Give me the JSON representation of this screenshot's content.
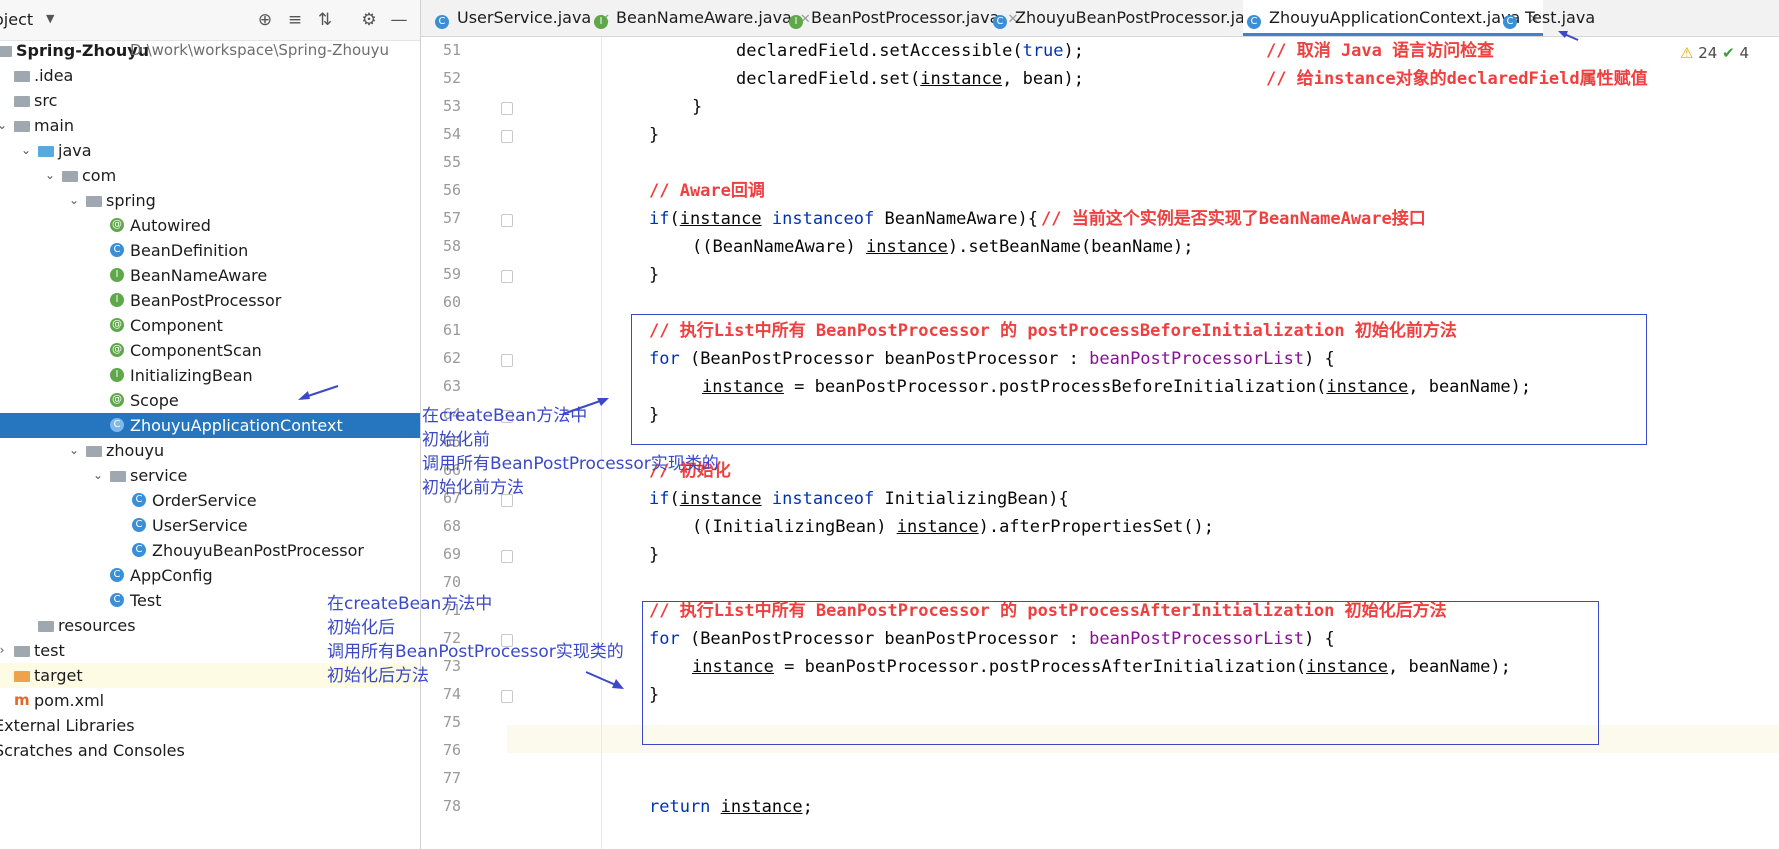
{
  "project_panel": {
    "title": "oject",
    "toolbar_icons": [
      "locate-icon",
      "expand-all-icon",
      "collapse-all-icon",
      "settings-icon",
      "hide-icon"
    ],
    "tree": [
      {
        "label": "Spring-Zhouyu",
        "path": "D:\\work\\workspace\\Spring-Zhouyu",
        "icon": "module-icon"
      },
      {
        "label": ".idea",
        "icon": "folder-icon"
      },
      {
        "label": "src",
        "icon": "folder-icon"
      },
      {
        "label": "main",
        "icon": "folder-icon"
      },
      {
        "label": "java",
        "icon": "source-folder-icon"
      },
      {
        "label": "com",
        "icon": "package-icon"
      },
      {
        "label": "spring",
        "icon": "package-icon"
      },
      {
        "label": "Autowired",
        "icon": "annotation-icon"
      },
      {
        "label": "BeanDefinition",
        "icon": "class-icon"
      },
      {
        "label": "BeanNameAware",
        "icon": "interface-icon"
      },
      {
        "label": "BeanPostProcessor",
        "icon": "interface-icon"
      },
      {
        "label": "Component",
        "icon": "annotation-icon"
      },
      {
        "label": "ComponentScan",
        "icon": "annotation-icon"
      },
      {
        "label": "InitializingBean",
        "icon": "interface-icon"
      },
      {
        "label": "Scope",
        "icon": "annotation-icon"
      },
      {
        "label": "ZhouyuApplicationContext",
        "icon": "class-icon"
      },
      {
        "label": "zhouyu",
        "icon": "package-icon"
      },
      {
        "label": "service",
        "icon": "package-icon"
      },
      {
        "label": "OrderService",
        "icon": "class-icon"
      },
      {
        "label": "UserService",
        "icon": "class-icon"
      },
      {
        "label": "ZhouyuBeanPostProcessor",
        "icon": "class-icon"
      },
      {
        "label": "AppConfig",
        "icon": "class-icon"
      },
      {
        "label": "Test",
        "icon": "runnable-class-icon"
      },
      {
        "label": "resources",
        "icon": "resources-folder-icon"
      },
      {
        "label": "test",
        "icon": "folder-icon"
      },
      {
        "label": "target",
        "icon": "excluded-folder-icon"
      },
      {
        "label": "pom.xml",
        "icon": "maven-icon"
      },
      {
        "label": "External Libraries",
        "icon": "library-icon"
      },
      {
        "label": "Scratches and Consoles",
        "icon": "scratch-icon"
      }
    ]
  },
  "tabs": [
    {
      "label": "UserService.java",
      "icon": "class-icon",
      "color": "#3b8fd6"
    },
    {
      "label": "BeanNameAware.java",
      "icon": "interface-icon",
      "color": "#5ea84a"
    },
    {
      "label": "BeanPostProcessor.java",
      "icon": "interface-icon",
      "color": "#5ea84a"
    },
    {
      "label": "ZhouyuBeanPostProcessor.java",
      "icon": "class-icon",
      "color": "#3b8fd6"
    },
    {
      "label": "ZhouyuApplicationContext.java",
      "icon": "class-icon",
      "color": "#3b8fd6"
    },
    {
      "label": "Test.java",
      "icon": "runnable-class-icon",
      "color": "#3b8fd6"
    }
  ],
  "inspection": {
    "warnings": "24",
    "ok": "4"
  },
  "code": {
    "line_numbers": [
      "51",
      "52",
      "53",
      "54",
      "55",
      "56",
      "57",
      "58",
      "59",
      "60",
      "61",
      "62",
      "63",
      "64",
      "65",
      "66",
      "67",
      "68",
      "69",
      "70",
      "71",
      "72",
      "73",
      "74",
      "75",
      "76",
      "77",
      "78"
    ],
    "l51_code": "declaredField.setAccessible(",
    "l51_kw": "true",
    "l51_end": ");",
    "l51_cmt": "// 取消 Java 语言访问检查",
    "l52_a": "declaredField.set(",
    "l52_inst": "instance",
    "l52_b": ", bean);",
    "l52_cmt": "// 给instance对象的declaredField属性赋值",
    "brace_close": "}",
    "l56_cmt": "// Aware回调",
    "if_kw": "if",
    "paren_open": "(",
    "instance": "instance",
    "instanceof": "instanceof",
    "l57_type": " BeanNameAware){",
    "l57_cmt": "// 当前这个实例是否实现了BeanNameAware接口",
    "l58_a": "((BeanNameAware) ",
    "l58_b": ").setBeanName(beanName);",
    "l61_cmt": "// 执行List中所有 BeanPostProcessor 的 postProcessBeforeInitialization 初始化前方法",
    "for_kw": "for",
    "for_mid": " (BeanPostProcessor beanPostProcessor : ",
    "list_field": "beanPostProcessorList",
    "for_end": ") {",
    "l63_b": " = beanPostProcessor.postProcessBeforeInitialization(",
    "l63_c": ", beanName);",
    "l66_cmt": "// 初始化",
    "l67_type": " InitializingBean){",
    "l68_a": "((InitializingBean) ",
    "l68_b": ").afterPropertiesSet();",
    "l71_cmt": "// 执行List中所有 BeanPostProcessor 的 postProcessAfterInitialization 初始化后方法",
    "l73_b": " = beanPostProcessor.postProcessAfterInitialization(",
    "l73_c": ", beanName);",
    "return_kw": "return",
    "l78_end": ";"
  },
  "annotations": {
    "before": [
      "在createBean方法中",
      "初始化前",
      "调用所有BeanPostProcessor实现类的",
      "初始化前方法"
    ],
    "after": [
      "在createBean方法中",
      "初始化后",
      "调用所有BeanPostProcessor实现类的",
      "初始化后方法"
    ],
    "color": "#3b49c9"
  }
}
